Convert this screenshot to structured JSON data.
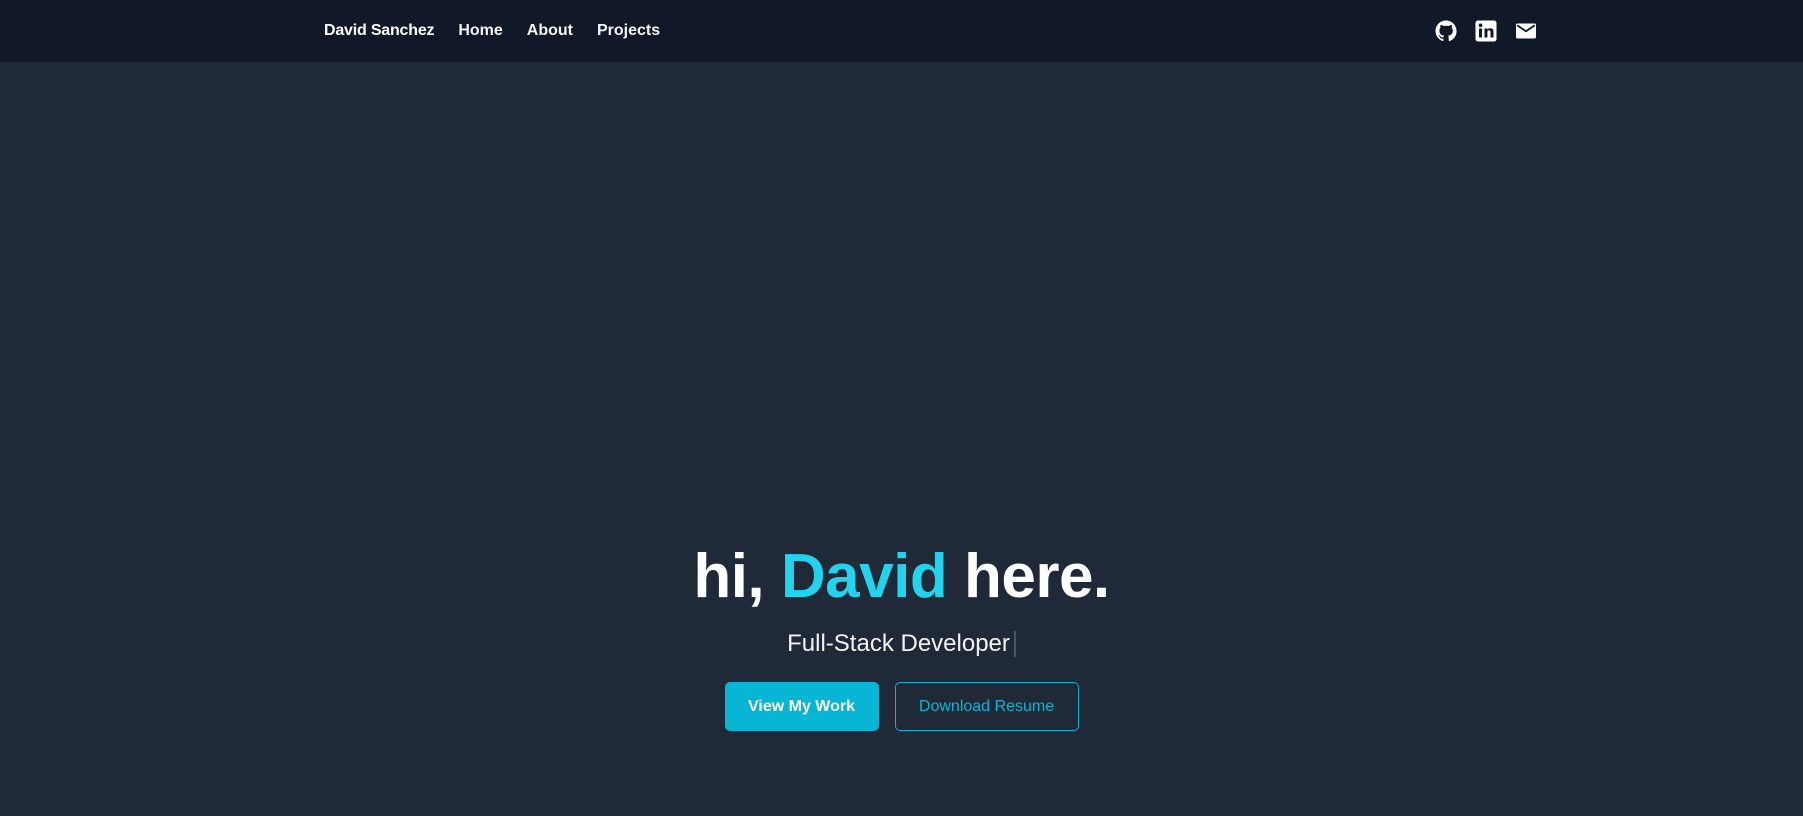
{
  "nav": {
    "brand": "David Sanchez",
    "links": [
      "Home",
      "About",
      "Projects"
    ],
    "social_icons": [
      "github-icon",
      "linkedin-icon",
      "mail-icon"
    ]
  },
  "hero": {
    "greeting_prefix": "hi,",
    "greeting_name": "David",
    "greeting_suffix": "here.",
    "subtitle": "Full-Stack Developer",
    "primary_button": "View My Work",
    "secondary_button": "Download Resume"
  },
  "colors": {
    "background": "#1f2937",
    "navbar": "#111827",
    "accent": "#22d3ee",
    "button": "#06b6d4"
  }
}
